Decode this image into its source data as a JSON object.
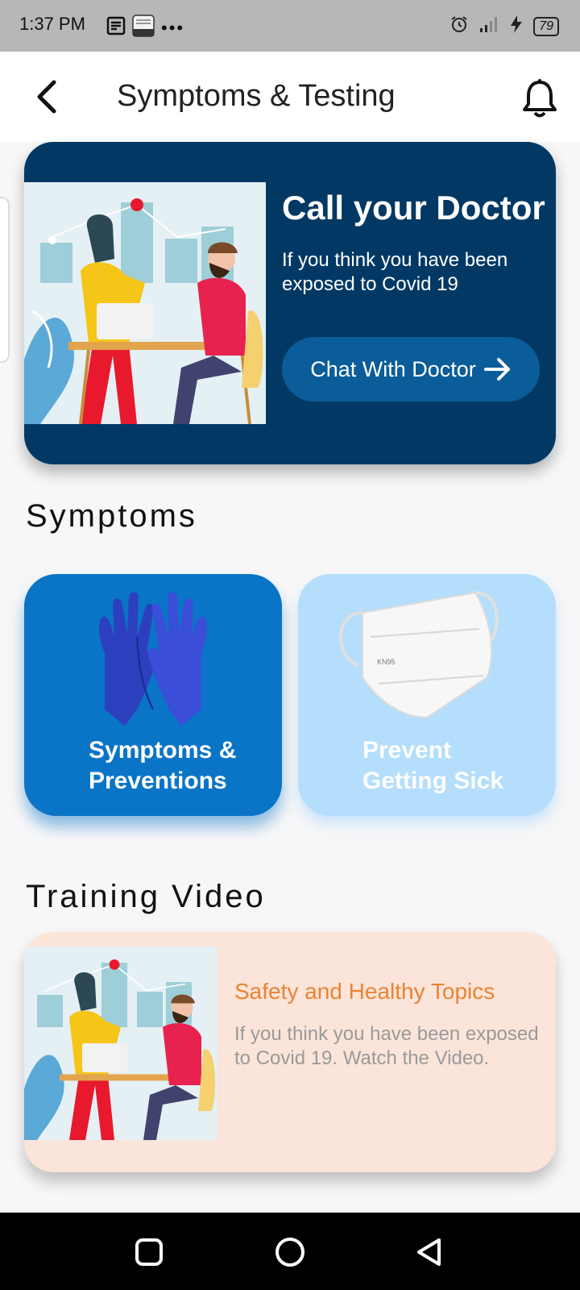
{
  "status_bar": {
    "time": "1:37 PM",
    "dots": "•••",
    "battery_level": "79",
    "icons": [
      "news-icon",
      "screenshot-icon",
      "alarm-icon",
      "signal-icon",
      "charging-icon",
      "battery-icon"
    ]
  },
  "app_bar": {
    "title": "Symptoms & Testing",
    "icons": [
      "back-arrow-icon",
      "bell-icon"
    ]
  },
  "doctor_card": {
    "title": "Call your Doctor",
    "subtitle": "If you think you have been exposed to Covid 19",
    "button_label": "Chat With Doctor",
    "colors": {
      "background": "#023964",
      "button": "#0b5d99"
    }
  },
  "symptoms": {
    "heading": "Symptoms",
    "tiles": [
      {
        "label_line1": "Symptoms &",
        "label_line2": "Preventions",
        "icon": "gloves-icon",
        "color": "#0a74c6"
      },
      {
        "label_line1": "Prevent",
        "label_line2": "Getting Sick",
        "icon": "mask-icon",
        "color": "#b4defc",
        "mask_text": "KN95"
      }
    ]
  },
  "training": {
    "heading": "Training Video",
    "card": {
      "title": "Safety and Healthy Topics",
      "description": "If you think you have been exposed to Covid 19. Watch the Video.",
      "colors": {
        "background": "#fbe4d9",
        "title": "#e98433"
      }
    }
  },
  "nav_bar": {
    "buttons": [
      "recents-icon",
      "home-icon",
      "back-icon"
    ]
  }
}
